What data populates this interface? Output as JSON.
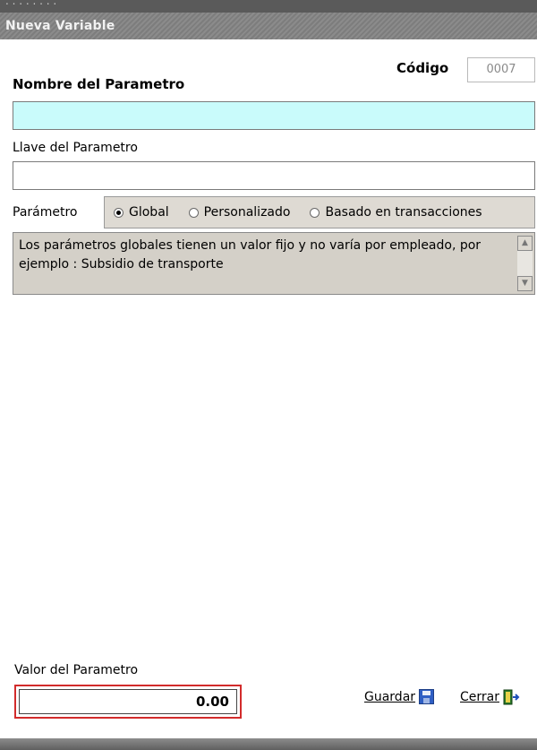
{
  "window": {
    "title": "Nueva Variable"
  },
  "codigo": {
    "label": "Código",
    "value": "0007"
  },
  "nombre": {
    "label": "Nombre del Parametro",
    "value": ""
  },
  "llave": {
    "label": "Llave del Parametro",
    "value": ""
  },
  "parametro": {
    "label": "Parámetro",
    "options": [
      "Global",
      "Personalizado",
      "Basado en transacciones"
    ],
    "selected": "Global"
  },
  "description": {
    "text": "Los parámetros globales tienen un valor fijo y no varía por empleado, por ejemplo : Subsidio de transporte"
  },
  "valor": {
    "label": "Valor del Parametro",
    "value": "0.00"
  },
  "actions": {
    "save_label": "Guardar",
    "close_label": "Cerrar"
  },
  "colors": {
    "title_bar": "#8b8b8b",
    "name_field_bg": "#c9fbfb",
    "value_highlight": "#d22b2b",
    "panel_bg": "#dedad3"
  }
}
